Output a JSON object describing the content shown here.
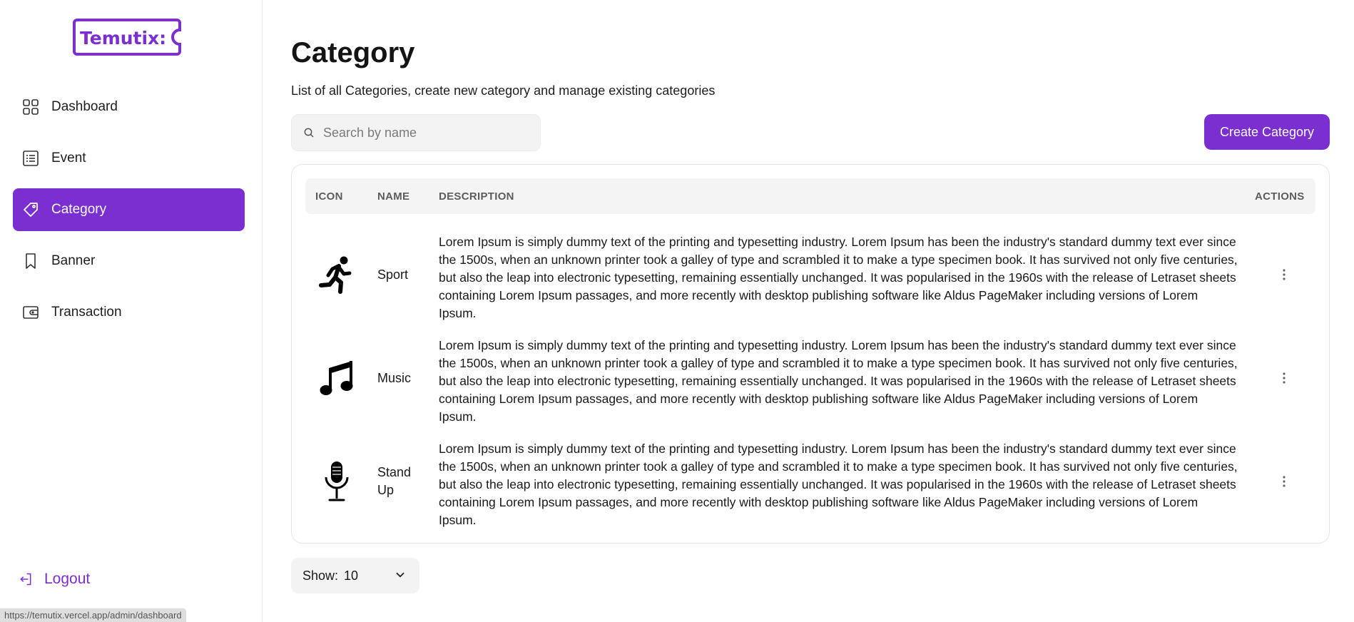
{
  "brand": {
    "name": "Temutix",
    "accent": "#7b2fd0"
  },
  "sidebar": {
    "items": [
      {
        "label": "Dashboard",
        "icon": "grid-icon",
        "active": false
      },
      {
        "label": "Event",
        "icon": "list-icon",
        "active": false
      },
      {
        "label": "Category",
        "icon": "tag-icon",
        "active": true
      },
      {
        "label": "Banner",
        "icon": "bookmark-icon",
        "active": false
      },
      {
        "label": "Transaction",
        "icon": "wallet-icon",
        "active": false
      }
    ],
    "logout_label": "Logout"
  },
  "status_bar": {
    "url": "https://temutix.vercel.app/admin/dashboard"
  },
  "header": {
    "title": "Category",
    "subtitle": "List of all Categories, create new category and manage existing categories"
  },
  "search": {
    "placeholder": "Search by name",
    "value": ""
  },
  "toolbar": {
    "create_label": "Create Category"
  },
  "table": {
    "columns": [
      "ICON",
      "NAME",
      "DESCRIPTION",
      "ACTIONS"
    ],
    "rows": [
      {
        "icon": "running-person-icon",
        "name": "Sport",
        "description": "Lorem Ipsum is simply dummy text of the printing and typesetting industry. Lorem Ipsum has been the industry's standard dummy text ever since the 1500s, when an unknown printer took a galley of type and scrambled it to make a type specimen book. It has survived not only five centuries, but also the leap into electronic typesetting, remaining essentially unchanged. It was popularised in the 1960s with the release of Letraset sheets containing Lorem Ipsum passages, and more recently with desktop publishing software like Aldus PageMaker including versions of Lorem Ipsum."
      },
      {
        "icon": "music-note-icon",
        "name": "Music",
        "description": "Lorem Ipsum is simply dummy text of the printing and typesetting industry. Lorem Ipsum has been the industry's standard dummy text ever since the 1500s, when an unknown printer took a galley of type and scrambled it to make a type specimen book. It has survived not only five centuries, but also the leap into electronic typesetting, remaining essentially unchanged. It was popularised in the 1960s with the release of Letraset sheets containing Lorem Ipsum passages, and more recently with desktop publishing software like Aldus PageMaker including versions of Lorem Ipsum."
      },
      {
        "icon": "microphone-icon",
        "name": "Stand Up",
        "description": "Lorem Ipsum is simply dummy text of the printing and typesetting industry. Lorem Ipsum has been the industry's standard dummy text ever since the 1500s, when an unknown printer took a galley of type and scrambled it to make a type specimen book. It has survived not only five centuries, but also the leap into electronic typesetting, remaining essentially unchanged. It was popularised in the 1960s with the release of Letraset sheets containing Lorem Ipsum passages, and more recently with desktop publishing software like Aldus PageMaker including versions of Lorem Ipsum."
      }
    ]
  },
  "pagination": {
    "show_label": "Show:",
    "show_value": "10"
  }
}
